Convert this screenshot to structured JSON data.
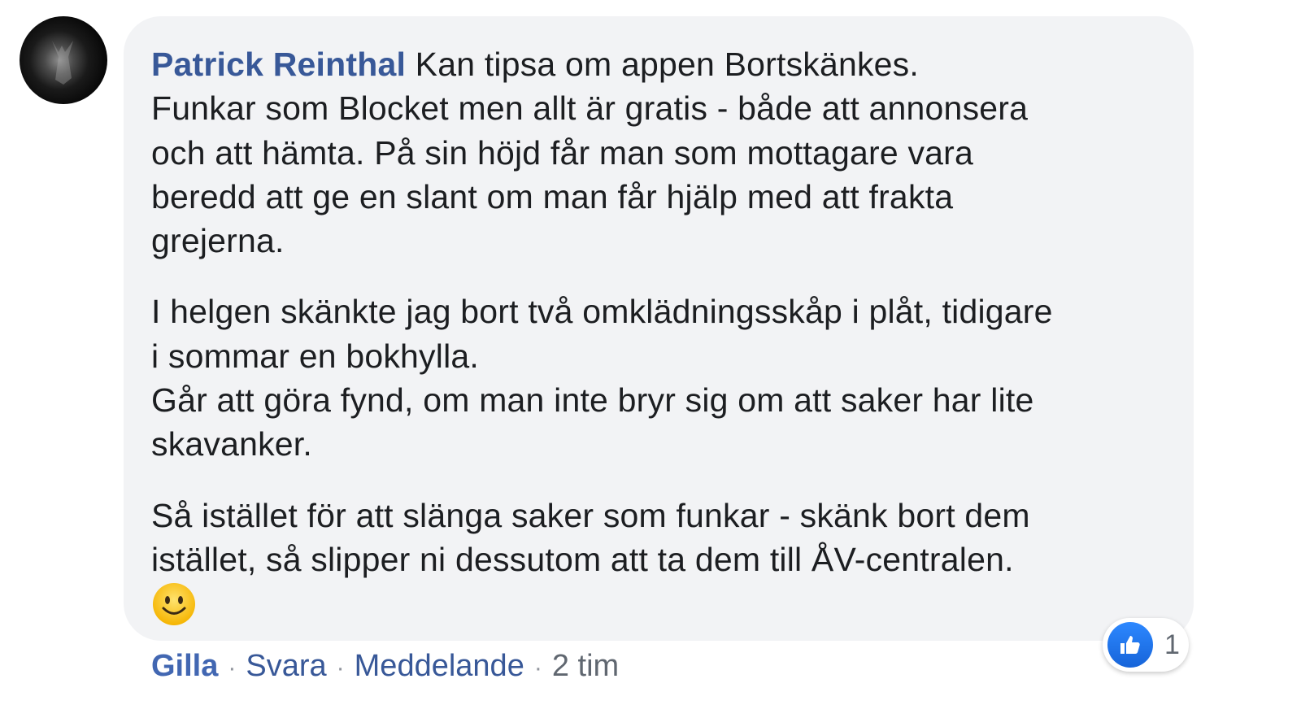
{
  "comment": {
    "author": "Patrick Reinthal",
    "first_line": " Kan tipsa om appen Bortskänkes.",
    "paragraph1_rest": "Funkar som Blocket men allt är gratis - både att annonsera\noch att hämta. På sin höjd får man som mottagare vara\nberedd att ge en slant om man får hjälp med att frakta\ngrejerna.",
    "paragraph2": "I helgen skänkte jag bort två omklädningsskåp i plåt, tidigare\ni sommar en bokhylla.\nGår att göra fynd, om man inte bryr sig om att saker har lite\nskavanker.",
    "paragraph3": "Så istället för att slänga saker som funkar - skänk bort dem\nistället, så slipper ni dessutom att ta dem till ÅV-centralen.",
    "emoji_icon": "smiley-face-icon"
  },
  "reactions": {
    "icon": "like-thumb-icon",
    "count": "1",
    "color": "#1877f2"
  },
  "actions": {
    "like_label": "Gilla",
    "reply_label": "Svara",
    "message_label": "Meddelande",
    "separator": "·",
    "timestamp": "2 tim"
  },
  "colors": {
    "author": "#385898",
    "bubble_bg": "#f2f3f5",
    "link": "#385898"
  }
}
